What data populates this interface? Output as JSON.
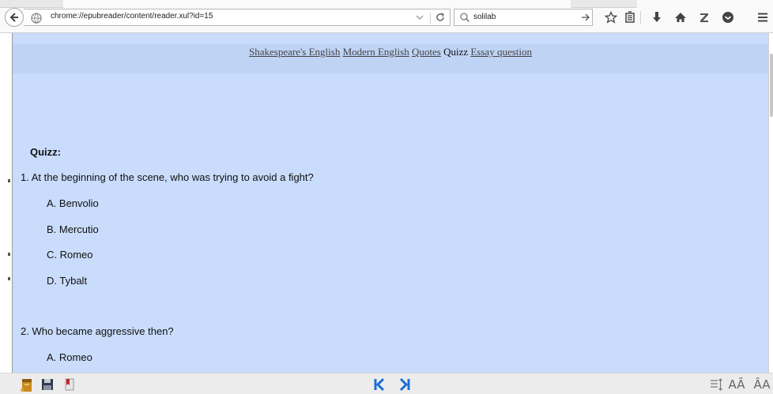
{
  "browser": {
    "url": "chrome://epubreader/content/reader.xul?id=15",
    "search_value": "solilab"
  },
  "nav": {
    "links": [
      "Shakespeare's English",
      "Modern English",
      "Quotes",
      "Quizz",
      "Essay question"
    ]
  },
  "quiz": {
    "title": "Quizz:",
    "q1": {
      "text": "1. At the beginning of the scene, who was trying to avoid a fight?",
      "options": [
        "A. Benvolio",
        "B. Mercutio",
        "C. Romeo",
        "D. Tybalt"
      ]
    },
    "q2": {
      "text": "2. Who became aggressive then?",
      "options": [
        "A. Romeo"
      ]
    }
  },
  "bottom": {
    "font_decrease_label": "AĀ",
    "font_increase_label": "ÂA"
  },
  "colors": {
    "reader_bg": "#c9dcfb",
    "nav_bg": "#bfd4f5",
    "nav_arrow": "#1a6fd6"
  },
  "icons": [
    "back-icon",
    "globe-icon",
    "dropdown-icon",
    "reload-icon",
    "search-icon",
    "go-icon",
    "star-icon",
    "reading-list-icon",
    "download-icon",
    "home-icon",
    "zotero-icon",
    "pocket-icon",
    "menu-icon",
    "bookshelf-icon",
    "save-icon",
    "bookmark-icon",
    "first-page-icon",
    "last-page-icon",
    "line-spacing-icon"
  ]
}
